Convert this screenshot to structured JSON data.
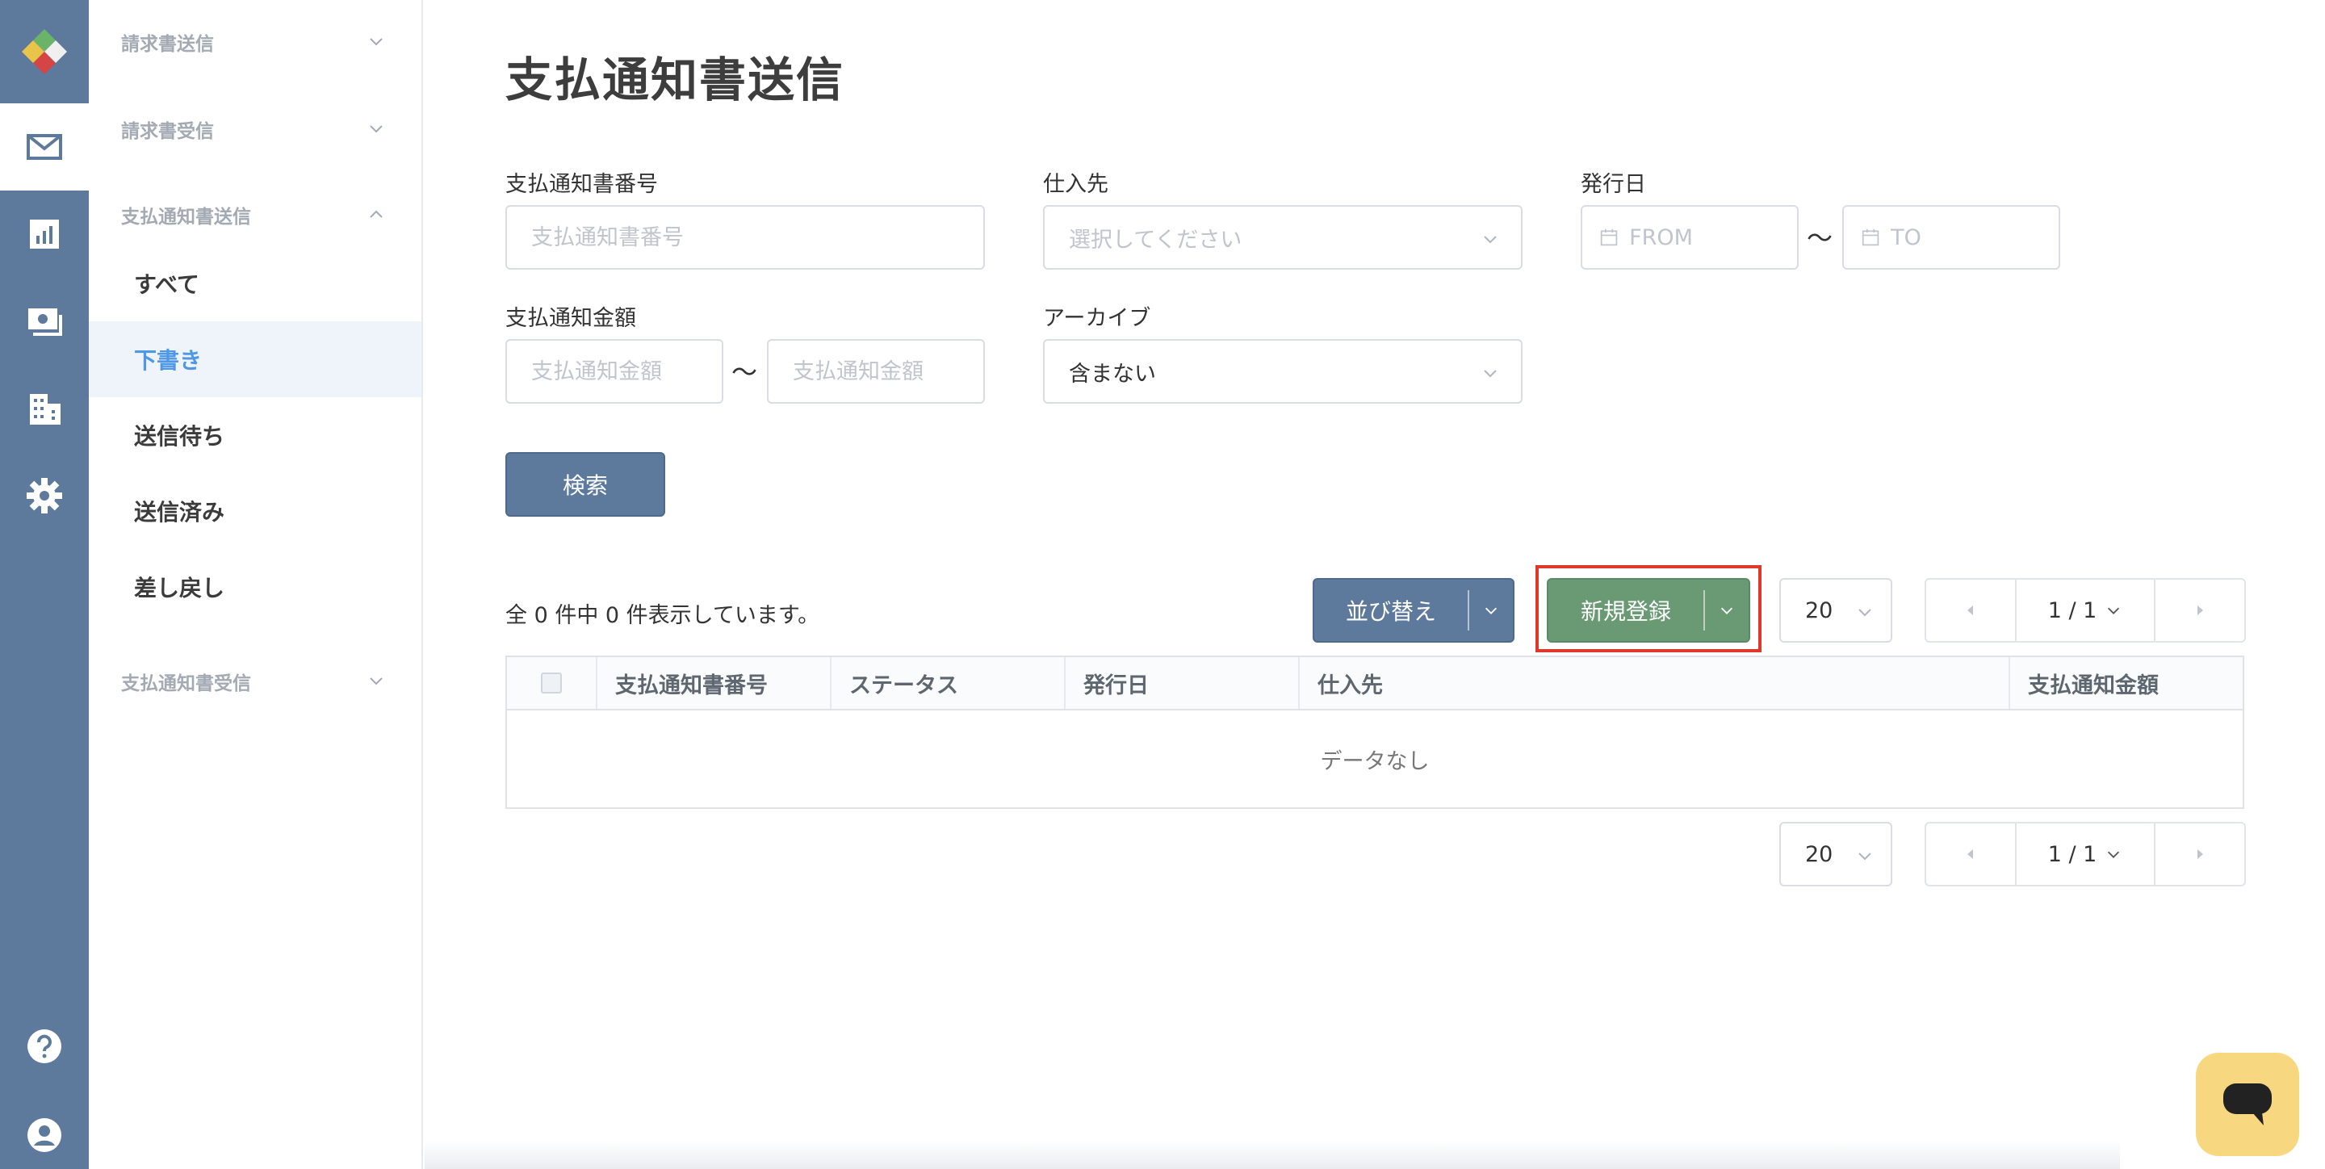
{
  "sidebar": {
    "groups": [
      {
        "label": "請求書送信"
      },
      {
        "label": "請求書受信"
      },
      {
        "label": "支払通知書送信"
      },
      {
        "label": "支払通知書受信"
      }
    ],
    "items": [
      {
        "label": "すべて"
      },
      {
        "label": "下書き",
        "active": true
      },
      {
        "label": "送信待ち"
      },
      {
        "label": "送信済み"
      },
      {
        "label": "差し戻し"
      }
    ]
  },
  "page": {
    "title": "支払通知書送信"
  },
  "filters": {
    "number": {
      "label": "支払通知書番号",
      "placeholder": "支払通知書番号"
    },
    "supplier": {
      "label": "仕入先",
      "placeholder": "選択してください"
    },
    "issue_date": {
      "label": "発行日",
      "from_placeholder": "FROM",
      "to_placeholder": "TO"
    },
    "amount": {
      "label": "支払通知金額",
      "min_placeholder": "支払通知金額",
      "max_placeholder": "支払通知金額"
    },
    "archive": {
      "label": "アーカイブ",
      "value": "含まない"
    },
    "range_separator": "〜",
    "search_label": "検索"
  },
  "toolbar": {
    "count_text": "全 0 件中 0 件表示しています。",
    "sort_label": "並び替え",
    "new_label": "新規登録",
    "page_size": "20",
    "page_indicator": "1 / 1"
  },
  "table": {
    "columns": [
      "支払通知書番号",
      "ステータス",
      "発行日",
      "仕入先",
      "支払通知金額"
    ],
    "empty_text": "データなし"
  },
  "colors": {
    "rail": "#5d7a9c",
    "primary": "#5d7a9c",
    "green": "#6a9a74",
    "active_link": "#4f98e6",
    "highlight": "#e0392b",
    "chat": "#f7d77f"
  }
}
